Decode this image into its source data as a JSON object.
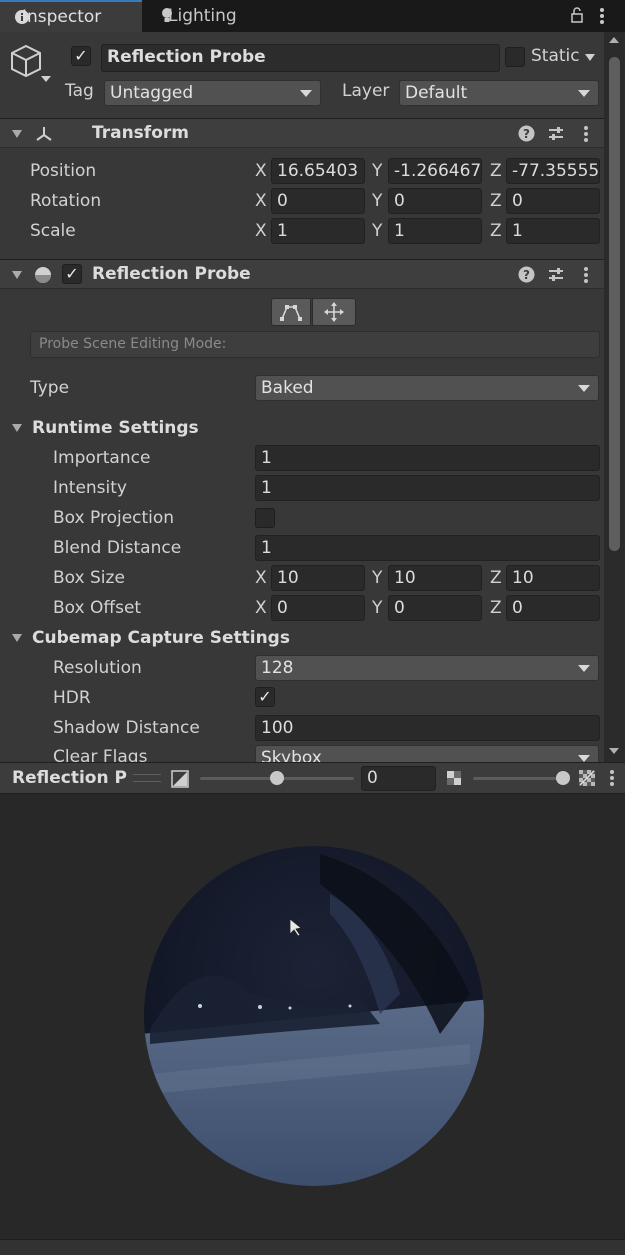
{
  "tabs": [
    {
      "label": "Inspector",
      "icon": "info-icon",
      "active": true
    },
    {
      "label": "Lighting",
      "icon": "lightbulb-icon",
      "active": false
    }
  ],
  "header": {
    "object_name": "Reflection Probe",
    "active_checked": true,
    "static_label": "Static",
    "tag_label": "Tag",
    "tag_value": "Untagged",
    "layer_label": "Layer",
    "layer_value": "Default"
  },
  "transform": {
    "title": "Transform",
    "rows": [
      {
        "label": "Position",
        "x": "16.65403",
        "y": "-1.266467",
        "z": "-77.35555"
      },
      {
        "label": "Rotation",
        "x": "0",
        "y": "0",
        "z": "0"
      },
      {
        "label": "Scale",
        "x": "1",
        "y": "1",
        "z": "1"
      }
    ]
  },
  "axes": {
    "x": "X",
    "y": "Y",
    "z": "Z"
  },
  "probe": {
    "title": "Reflection Probe",
    "enabled": true,
    "editing_mode_placeholder": "Probe Scene Editing Mode:",
    "type_label": "Type",
    "type_value": "Baked",
    "runtime": {
      "title": "Runtime Settings",
      "importance_label": "Importance",
      "importance": "1",
      "intensity_label": "Intensity",
      "intensity": "1",
      "box_projection_label": "Box Projection",
      "box_projection": false,
      "blend_distance_label": "Blend Distance",
      "blend_distance": "1",
      "box_size_label": "Box Size",
      "box_size": {
        "x": "10",
        "y": "10",
        "z": "10"
      },
      "box_offset_label": "Box Offset",
      "box_offset": {
        "x": "0",
        "y": "0",
        "z": "0"
      }
    },
    "capture": {
      "title": "Cubemap Capture Settings",
      "resolution_label": "Resolution",
      "resolution": "128",
      "hdr_label": "HDR",
      "hdr": true,
      "shadow_distance_label": "Shadow Distance",
      "shadow_distance": "100",
      "clear_flags_label": "Clear Flags",
      "clear_flags": "Skybox"
    }
  },
  "preview": {
    "title": "Reflection P",
    "exposure_value": "0",
    "exposure_slider": 0.5,
    "mip_slider": 1.0
  },
  "colors": {
    "accent": "#3a79bb",
    "panel": "#383838",
    "field": "#2a2a2a"
  }
}
